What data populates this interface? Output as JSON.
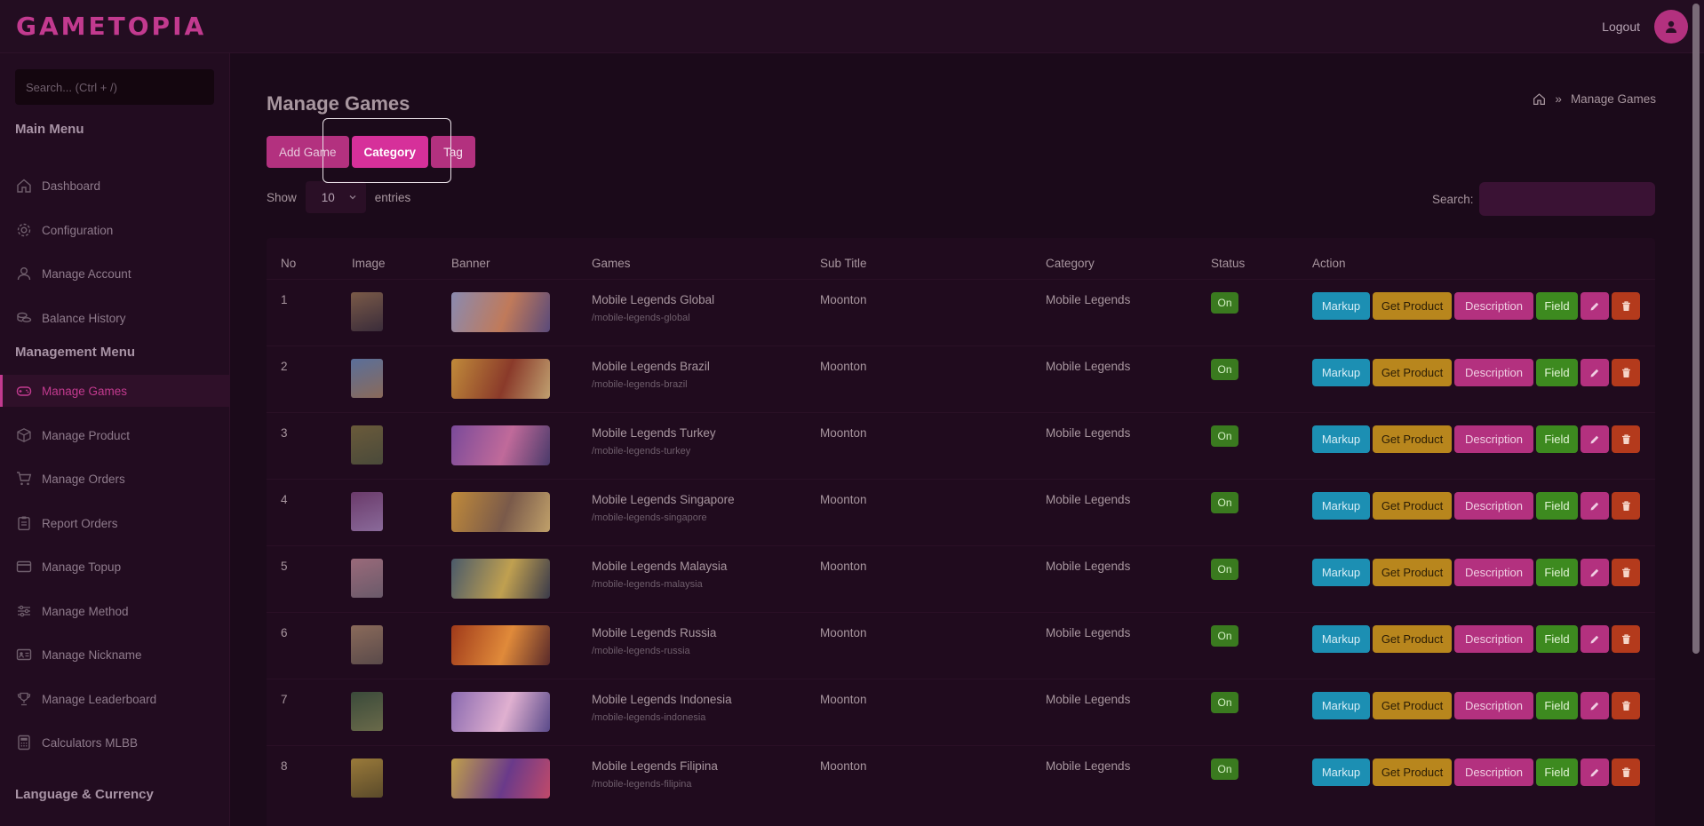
{
  "brand": {
    "logo": "GAMETOPIA"
  },
  "topbar": {
    "logout": "Logout"
  },
  "sidebar": {
    "search_placeholder": "Search... (Ctrl + /)",
    "main_menu_title": "Main Menu",
    "main_items": [
      {
        "label": "Dashboard",
        "icon": "home-icon"
      },
      {
        "label": "Configuration",
        "icon": "gear-icon"
      },
      {
        "label": "Manage Account",
        "icon": "user-icon"
      },
      {
        "label": "Balance History",
        "icon": "coins-icon"
      }
    ],
    "management_title": "Management Menu",
    "management_items": [
      {
        "label": "Manage Games",
        "icon": "gamepad-icon",
        "active": true
      },
      {
        "label": "Manage Product",
        "icon": "box-icon"
      },
      {
        "label": "Manage Orders",
        "icon": "cart-icon"
      },
      {
        "label": "Report Orders",
        "icon": "clipboard-icon"
      },
      {
        "label": "Manage Topup",
        "icon": "card-icon"
      },
      {
        "label": "Manage Method",
        "icon": "sliders-icon"
      },
      {
        "label": "Manage Nickname",
        "icon": "id-card-icon"
      },
      {
        "label": "Manage Leaderboard",
        "icon": "trophy-icon"
      },
      {
        "label": "Calculators MLBB",
        "icon": "calculator-icon"
      }
    ],
    "lang_title": "Language & Currency"
  },
  "page": {
    "title": "Manage Games",
    "breadcrumb_current": "Manage Games",
    "buttons": {
      "add": "Add Game",
      "category": "Category",
      "tag": "Tag"
    },
    "show": "Show",
    "entries_value": "10",
    "entries": "entries",
    "search_label": "Search:"
  },
  "table": {
    "headers": [
      "No",
      "Image",
      "Banner",
      "Games",
      "Sub Title",
      "Category",
      "Status",
      "Action"
    ],
    "action_labels": {
      "markup": "Markup",
      "get_product": "Get Product",
      "description": "Description",
      "field": "Field"
    },
    "rows": [
      {
        "no": "1",
        "game": "Mobile Legends Global",
        "slug": "/mobile-legends-global",
        "subtitle": "Moonton",
        "category": "Mobile Legends",
        "status": "On"
      },
      {
        "no": "2",
        "game": "Mobile Legends Brazil",
        "slug": "/mobile-legends-brazil",
        "subtitle": "Moonton",
        "category": "Mobile Legends",
        "status": "On"
      },
      {
        "no": "3",
        "game": "Mobile Legends Turkey",
        "slug": "/mobile-legends-turkey",
        "subtitle": "Moonton",
        "category": "Mobile Legends",
        "status": "On"
      },
      {
        "no": "4",
        "game": "Mobile Legends Singapore",
        "slug": "/mobile-legends-singapore",
        "subtitle": "Moonton",
        "category": "Mobile Legends",
        "status": "On"
      },
      {
        "no": "5",
        "game": "Mobile Legends Malaysia",
        "slug": "/mobile-legends-malaysia",
        "subtitle": "Moonton",
        "category": "Mobile Legends",
        "status": "On"
      },
      {
        "no": "6",
        "game": "Mobile Legends Russia",
        "slug": "/mobile-legends-russia",
        "subtitle": "Moonton",
        "category": "Mobile Legends",
        "status": "On"
      },
      {
        "no": "7",
        "game": "Mobile Legends Indonesia",
        "slug": "/mobile-legends-indonesia",
        "subtitle": "Moonton",
        "category": "Mobile Legends",
        "status": "On"
      },
      {
        "no": "8",
        "game": "Mobile Legends Filipina",
        "slug": "/mobile-legends-filipina",
        "subtitle": "Moonton",
        "category": "Mobile Legends",
        "status": "On"
      }
    ]
  },
  "colors": {
    "accent": "#c23a8f",
    "status_on": "#3a7a1f",
    "markup": "#1c8fb3",
    "get_product": "#b8861d",
    "delete": "#b43a1c"
  }
}
